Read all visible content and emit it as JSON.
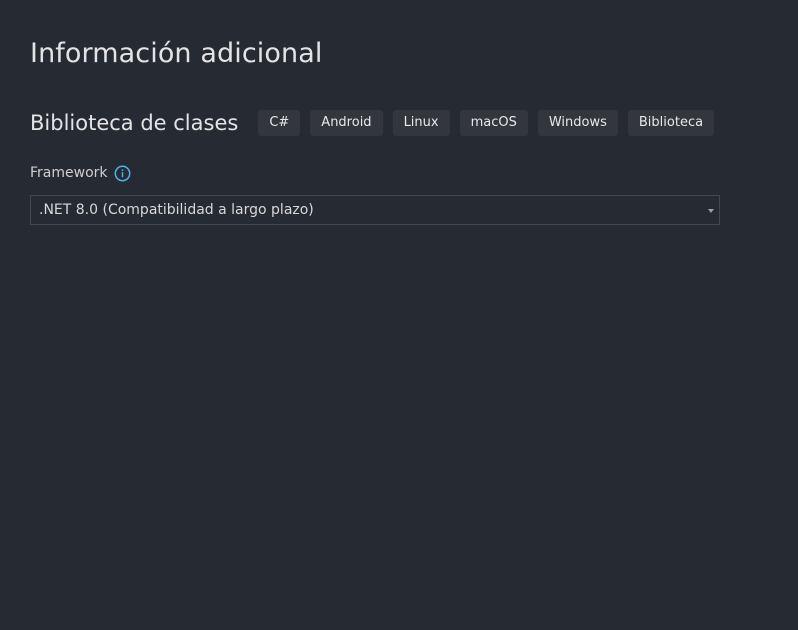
{
  "page": {
    "title": "Información adicional"
  },
  "template": {
    "name": "Biblioteca de clases",
    "tags": [
      "C#",
      "Android",
      "Linux",
      "macOS",
      "Windows",
      "Biblioteca"
    ]
  },
  "framework": {
    "label": "Framework",
    "info_icon": "info-icon",
    "selected_value": ".NET 8.0 (Compatibilidad a largo plazo)"
  },
  "colors": {
    "background": "#262a33",
    "tag_background": "#33363d",
    "info_icon": "#4fb3e8",
    "field_border": "#434750"
  }
}
